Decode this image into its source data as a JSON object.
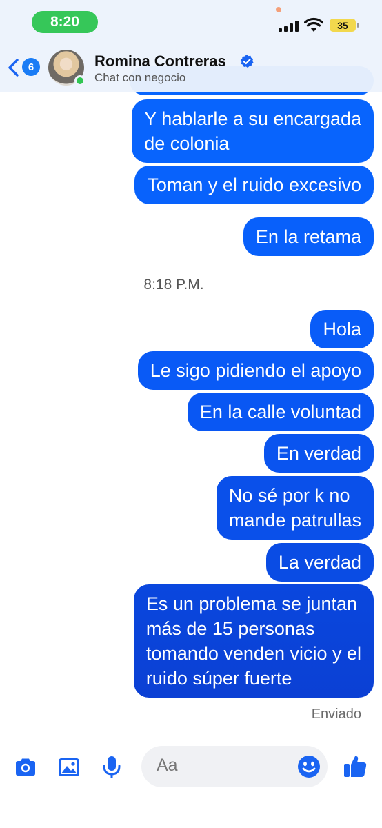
{
  "status_bar": {
    "time": "8:20",
    "battery": "35"
  },
  "header": {
    "back_count": "6",
    "name": "Romina Contreras",
    "subtitle": "Chat con negocio"
  },
  "messages": [
    {
      "text": "Y hablarle a su encargada\nde colonia"
    },
    {
      "text": "Toman y el ruido excesivo"
    },
    {
      "text": "En la retama"
    },
    {
      "text": "Hola"
    },
    {
      "text": "Le sigo pidiendo el apoyo"
    },
    {
      "text": "En la calle voluntad"
    },
    {
      "text": "En verdad"
    },
    {
      "text": "No sé por k no\nmande patrullas"
    },
    {
      "text": "La verdad"
    },
    {
      "text": "Es un problema se juntan\nmás de 15 personas\ntomando venden vicio y el\nruido súper fuerte"
    }
  ],
  "time_separator": "8:18 P.M.",
  "delivery_status": "Enviado",
  "composer": {
    "placeholder": "Aa"
  },
  "colors": {
    "bubble_top": "#0866ff",
    "bubble_bottom": "#0b3fd6",
    "accent": "#1a64f2"
  }
}
